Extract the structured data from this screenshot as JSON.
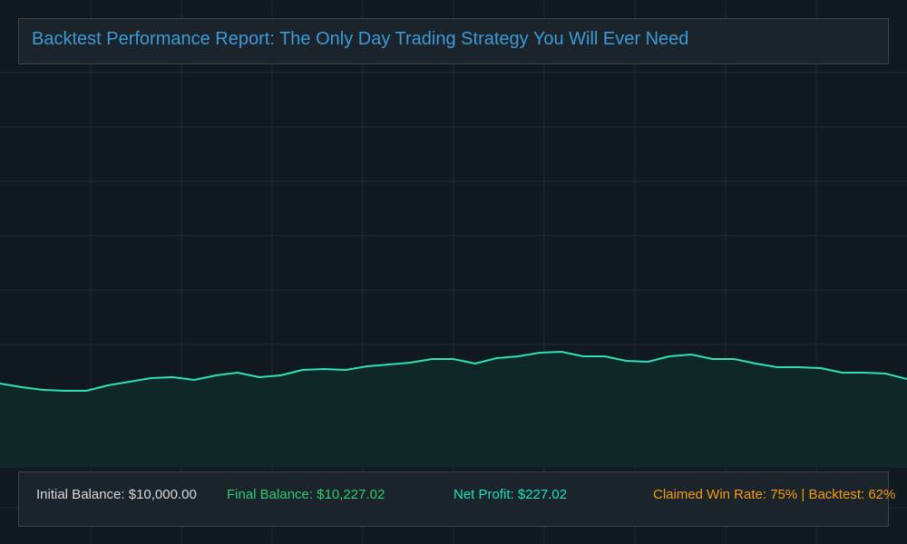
{
  "header": {
    "title": "Backtest Performance Report: The Only Day Trading Strategy You Will Ever Need"
  },
  "stats": {
    "initial_balance": "Initial Balance: $10,000.00",
    "final_balance": "Final Balance: $10,227.02",
    "net_profit": "Net Profit: $227.02",
    "win_rate": "Claimed Win Rate: 75% | Backtest: 62%"
  },
  "colors": {
    "background": "#101820",
    "grid": "#1e2e30",
    "line": "#2de0b8",
    "area_fill": "#0f2a28",
    "title": "#3d9ad8",
    "initial": "#d8d8d8",
    "final": "#2ecc71",
    "net": "#1ee0c0",
    "winrate": "#f39c12"
  },
  "chart_data": {
    "type": "area",
    "series": [
      {
        "values": [
          423,
          427,
          430,
          431,
          431,
          425,
          421,
          417,
          416,
          419,
          414,
          411,
          416,
          414,
          408,
          407,
          408,
          404,
          402,
          400,
          396,
          396,
          401,
          395,
          393,
          389,
          388,
          393,
          393,
          398,
          399,
          393,
          391,
          396,
          396,
          401,
          405,
          405,
          406,
          411,
          411,
          412,
          418
        ]
      }
    ],
    "grid": true
  }
}
